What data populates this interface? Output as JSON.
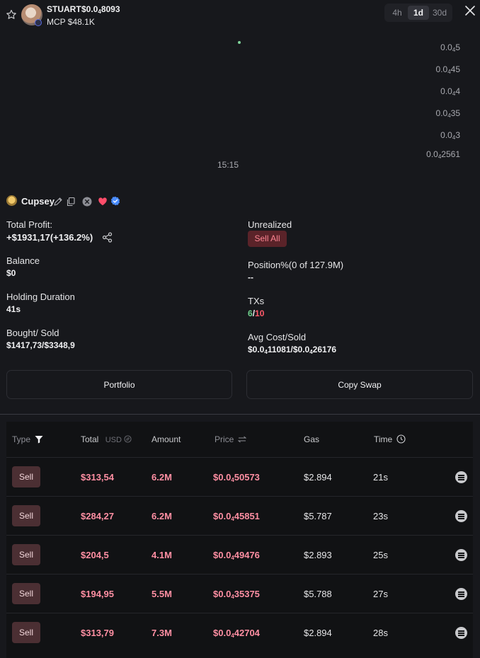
{
  "header": {
    "ticker": "STUART",
    "price": "$0.0₈4 8093",
    "mcp": "MCP $48.1K",
    "timeframes": [
      {
        "label": "4h",
        "active": false
      },
      {
        "label": "1d",
        "active": true
      },
      {
        "label": "30d",
        "active": false
      }
    ]
  },
  "chart": {
    "y_ticks": [
      "0.0₈5",
      "0.0₈45",
      "0.0₈4",
      "0.0₈35",
      "0.0₈3",
      "0.0₈2561"
    ],
    "x_tick": "15:15"
  },
  "chart_data": {
    "type": "scatter",
    "x": [
      "15:15"
    ],
    "y_ticks": [
      "0.0₈5",
      "0.0₈45",
      "0.0₈4",
      "0.0₈35",
      "0.0₈3",
      "0.0₈2561"
    ],
    "title": "",
    "xlabel": "",
    "ylabel": ""
  },
  "trader": {
    "name": "Cupsey",
    "accent_like": "#ff4d6a",
    "accent_verified": "#4a8cff"
  },
  "stats": {
    "total_profit_label": "Total Profit:",
    "total_profit_value": "+$1931,17(+136.2%)",
    "unrealized_label": "Unrealized",
    "sell_all_label": "Sell All",
    "balance_label": "Balance",
    "balance_value": "$0",
    "position_label": "Position%(0 of 127.9M)",
    "position_value": "--",
    "holding_label": "Holding Duration",
    "holding_value": "41s",
    "txs_label": "TXs",
    "txs_buy": "6",
    "txs_sep": "/",
    "txs_sell": "10",
    "bought_sold_label": "Bought/ Sold",
    "bought_sold_value": "$1417,73/$3348,9",
    "avg_cost_label": "Avg Cost/Sold",
    "avg_cost_value": "$0.0₈11081/$0.0₈26176"
  },
  "actions": {
    "portfolio_label": "Portfolio",
    "copy_swap_label": "Copy Swap"
  },
  "table": {
    "headers": {
      "type": "Type",
      "total": "Total",
      "total_unit": "USD",
      "amount": "Amount",
      "price": "Price",
      "gas": "Gas",
      "time": "Time"
    },
    "rows": [
      {
        "type": "Sell",
        "total": "$313,54",
        "amount": "6.2M",
        "price": "$0.0₈50573",
        "gas": "$2.894",
        "time": "21s"
      },
      {
        "type": "Sell",
        "total": "$284,27",
        "amount": "6.2M",
        "price": "$0.0₈45851",
        "gas": "$5.787",
        "time": "23s"
      },
      {
        "type": "Sell",
        "total": "$204,5",
        "amount": "4.1M",
        "price": "$0.0₈49476",
        "gas": "$2.893",
        "time": "25s"
      },
      {
        "type": "Sell",
        "total": "$194,95",
        "amount": "5.5M",
        "price": "$0.0₈35375",
        "gas": "$5.788",
        "time": "27s"
      },
      {
        "type": "Sell",
        "total": "$313,79",
        "amount": "7.3M",
        "price": "$0.0₈42704",
        "gas": "$2.894",
        "time": "28s"
      }
    ]
  }
}
